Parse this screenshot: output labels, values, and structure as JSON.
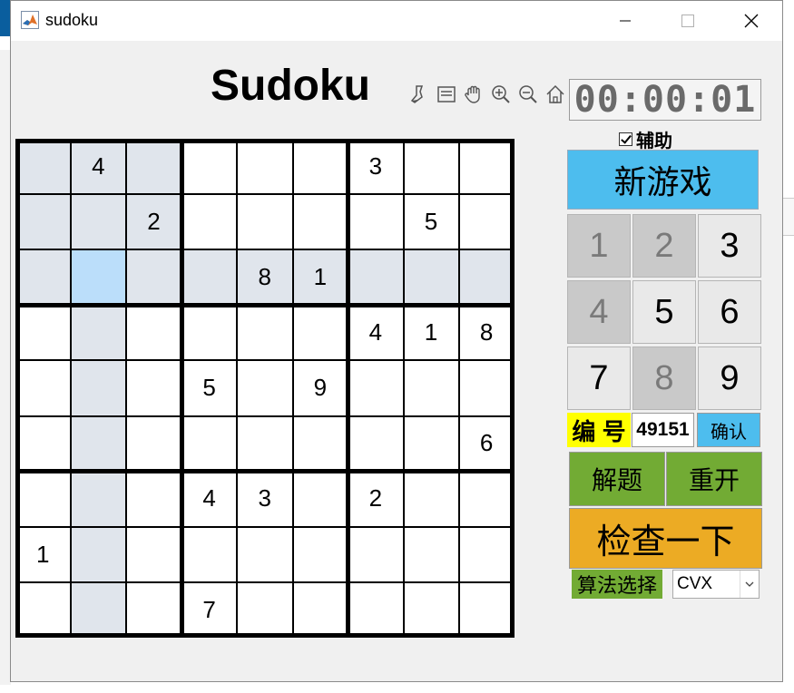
{
  "window": {
    "title": "sudoku",
    "controls": [
      "minimize",
      "maximize",
      "close"
    ]
  },
  "header": {
    "title": "Sudoku"
  },
  "toolbar": {
    "tools": [
      "brush-icon",
      "datatip-icon",
      "pan-hand-icon",
      "zoom-in-icon",
      "zoom-out-icon",
      "home-icon"
    ]
  },
  "timer": {
    "value": "00:00:01"
  },
  "assist": {
    "label": "辅助",
    "checked": true
  },
  "controls": {
    "new_game": "新游戏",
    "numpad": [
      {
        "label": "1",
        "enabled": false
      },
      {
        "label": "2",
        "enabled": false
      },
      {
        "label": "3",
        "enabled": true
      },
      {
        "label": "4",
        "enabled": false
      },
      {
        "label": "5",
        "enabled": true
      },
      {
        "label": "6",
        "enabled": true
      },
      {
        "label": "7",
        "enabled": true
      },
      {
        "label": "8",
        "enabled": false
      },
      {
        "label": "9",
        "enabled": true
      }
    ],
    "id_label": "编 号",
    "id_value": "49151",
    "confirm": "确认",
    "solve": "解题",
    "restart": "重开",
    "check": "检查一下",
    "algo_label": "算法选择",
    "algo_value": "CVX"
  },
  "colors": {
    "highlight": "#e0e5ec",
    "selected": "#bbdefa",
    "blue_button": "#4dbdee",
    "green_button": "#72ab34",
    "orange_button": "#ecab24",
    "yellow_label": "#ffff00"
  },
  "board": {
    "grid": [
      [
        "",
        "4",
        "",
        "",
        "",
        "",
        "3",
        "",
        ""
      ],
      [
        "",
        "",
        "2",
        "",
        "",
        "",
        "",
        "5",
        ""
      ],
      [
        "",
        "",
        "",
        "",
        "8",
        "1",
        "",
        "",
        ""
      ],
      [
        "",
        "",
        "",
        "",
        "",
        "",
        "4",
        "1",
        "8"
      ],
      [
        "",
        "",
        "",
        "5",
        "",
        "9",
        "",
        "",
        ""
      ],
      [
        "",
        "",
        "",
        "",
        "",
        "",
        "",
        "",
        "6"
      ],
      [
        "",
        "",
        "",
        "4",
        "3",
        "",
        "2",
        "",
        ""
      ],
      [
        "1",
        "",
        "",
        "",
        "",
        "",
        "",
        "",
        ""
      ],
      [
        "",
        "",
        "",
        "7",
        "",
        "",
        "",
        "",
        ""
      ]
    ],
    "selected": {
      "row": 2,
      "col": 1
    }
  }
}
